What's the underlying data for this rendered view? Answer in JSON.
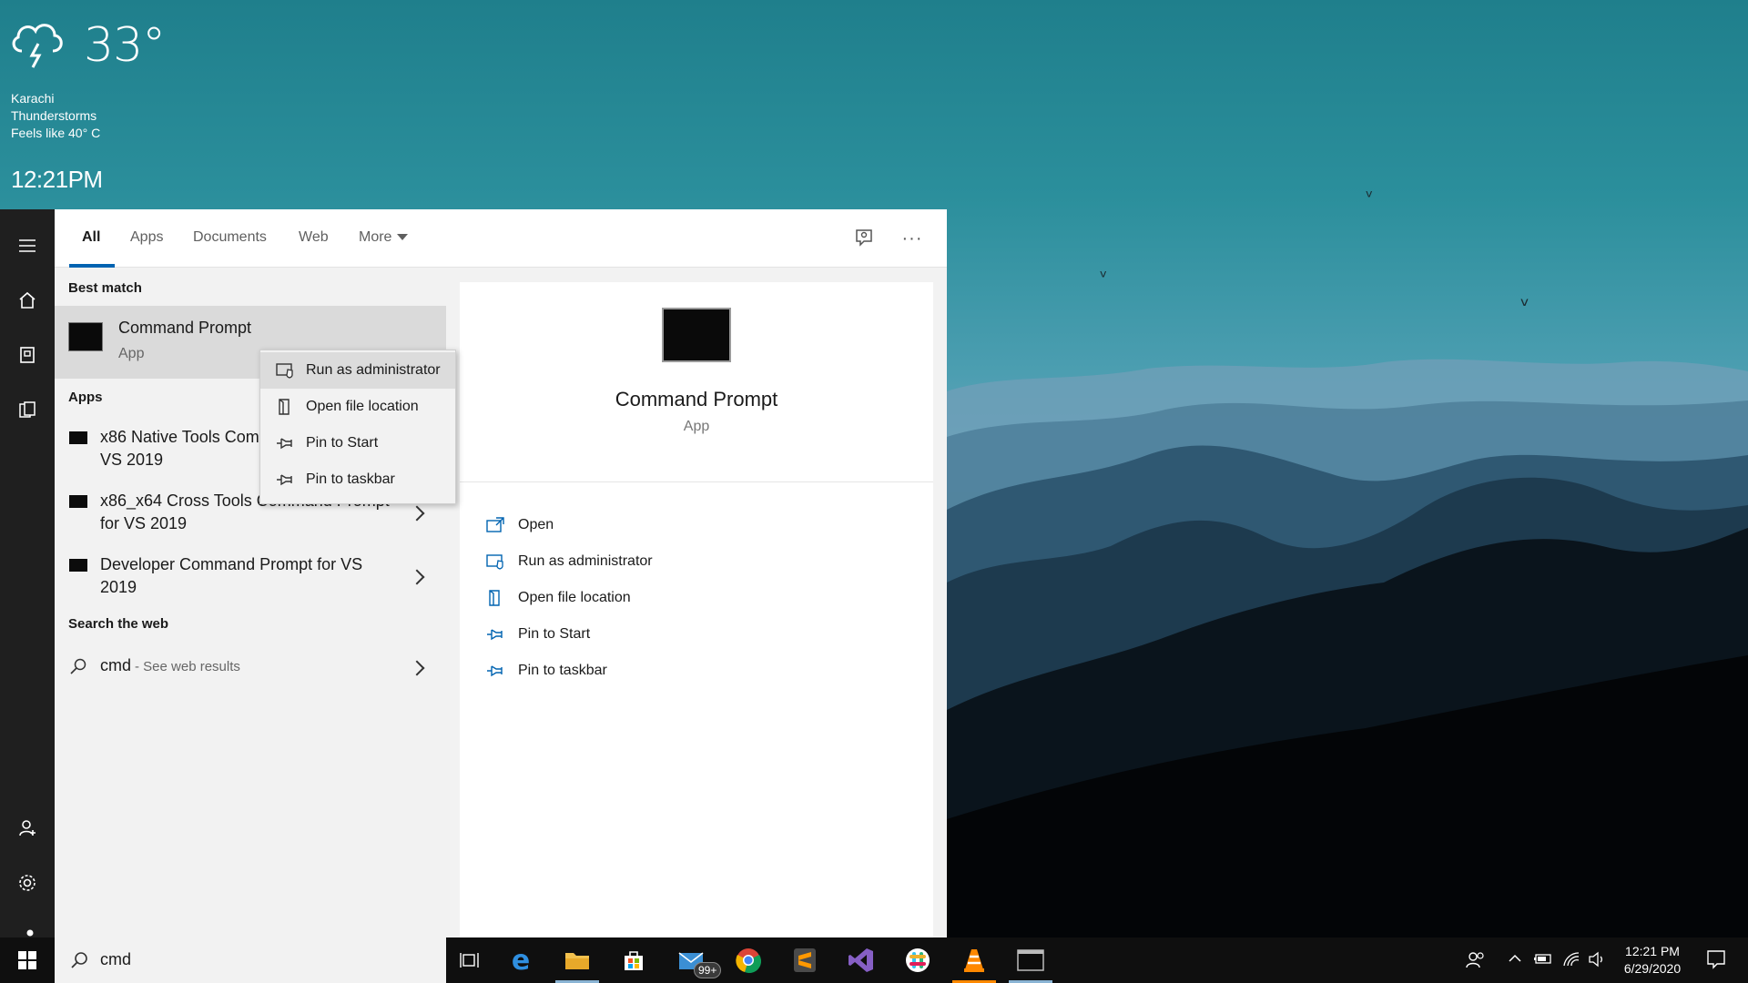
{
  "weather": {
    "temperature": "33°",
    "city": "Karachi",
    "condition": "Thunderstorms",
    "feels_like": "Feels like 40° C",
    "time": "12:21PM"
  },
  "tabs": {
    "all": "All",
    "apps": "Apps",
    "documents": "Documents",
    "web": "Web",
    "more": "More"
  },
  "results": {
    "best_match_heading": "Best match",
    "best_match": {
      "title": "Command Prompt",
      "subtitle": "App"
    },
    "apps_heading": "Apps",
    "apps": [
      {
        "title": "x86 Native Tools Command Prompt for VS 2019"
      },
      {
        "title": "x86_x64 Cross Tools Command Prompt for VS 2019"
      },
      {
        "title": "Developer Command Prompt for VS 2019"
      }
    ],
    "web_heading": "Search the web",
    "web_query": "cmd",
    "web_suffix": " - See web results"
  },
  "context_menu": {
    "items": [
      "Run as administrator",
      "Open file location",
      "Pin to Start",
      "Pin to taskbar"
    ]
  },
  "preview": {
    "title": "Command Prompt",
    "subtitle": "App",
    "actions": [
      "Open",
      "Run as administrator",
      "Open file location",
      "Pin to Start",
      "Pin to taskbar"
    ]
  },
  "search": {
    "query": "cmd"
  },
  "taskbar": {
    "mail_badge": "99+",
    "time": "12:21 PM",
    "date": "6/29/2020"
  },
  "colors": {
    "accent": "#0063b1",
    "taskbar": "#0f0f0f",
    "panel": "#f2f2f2"
  }
}
